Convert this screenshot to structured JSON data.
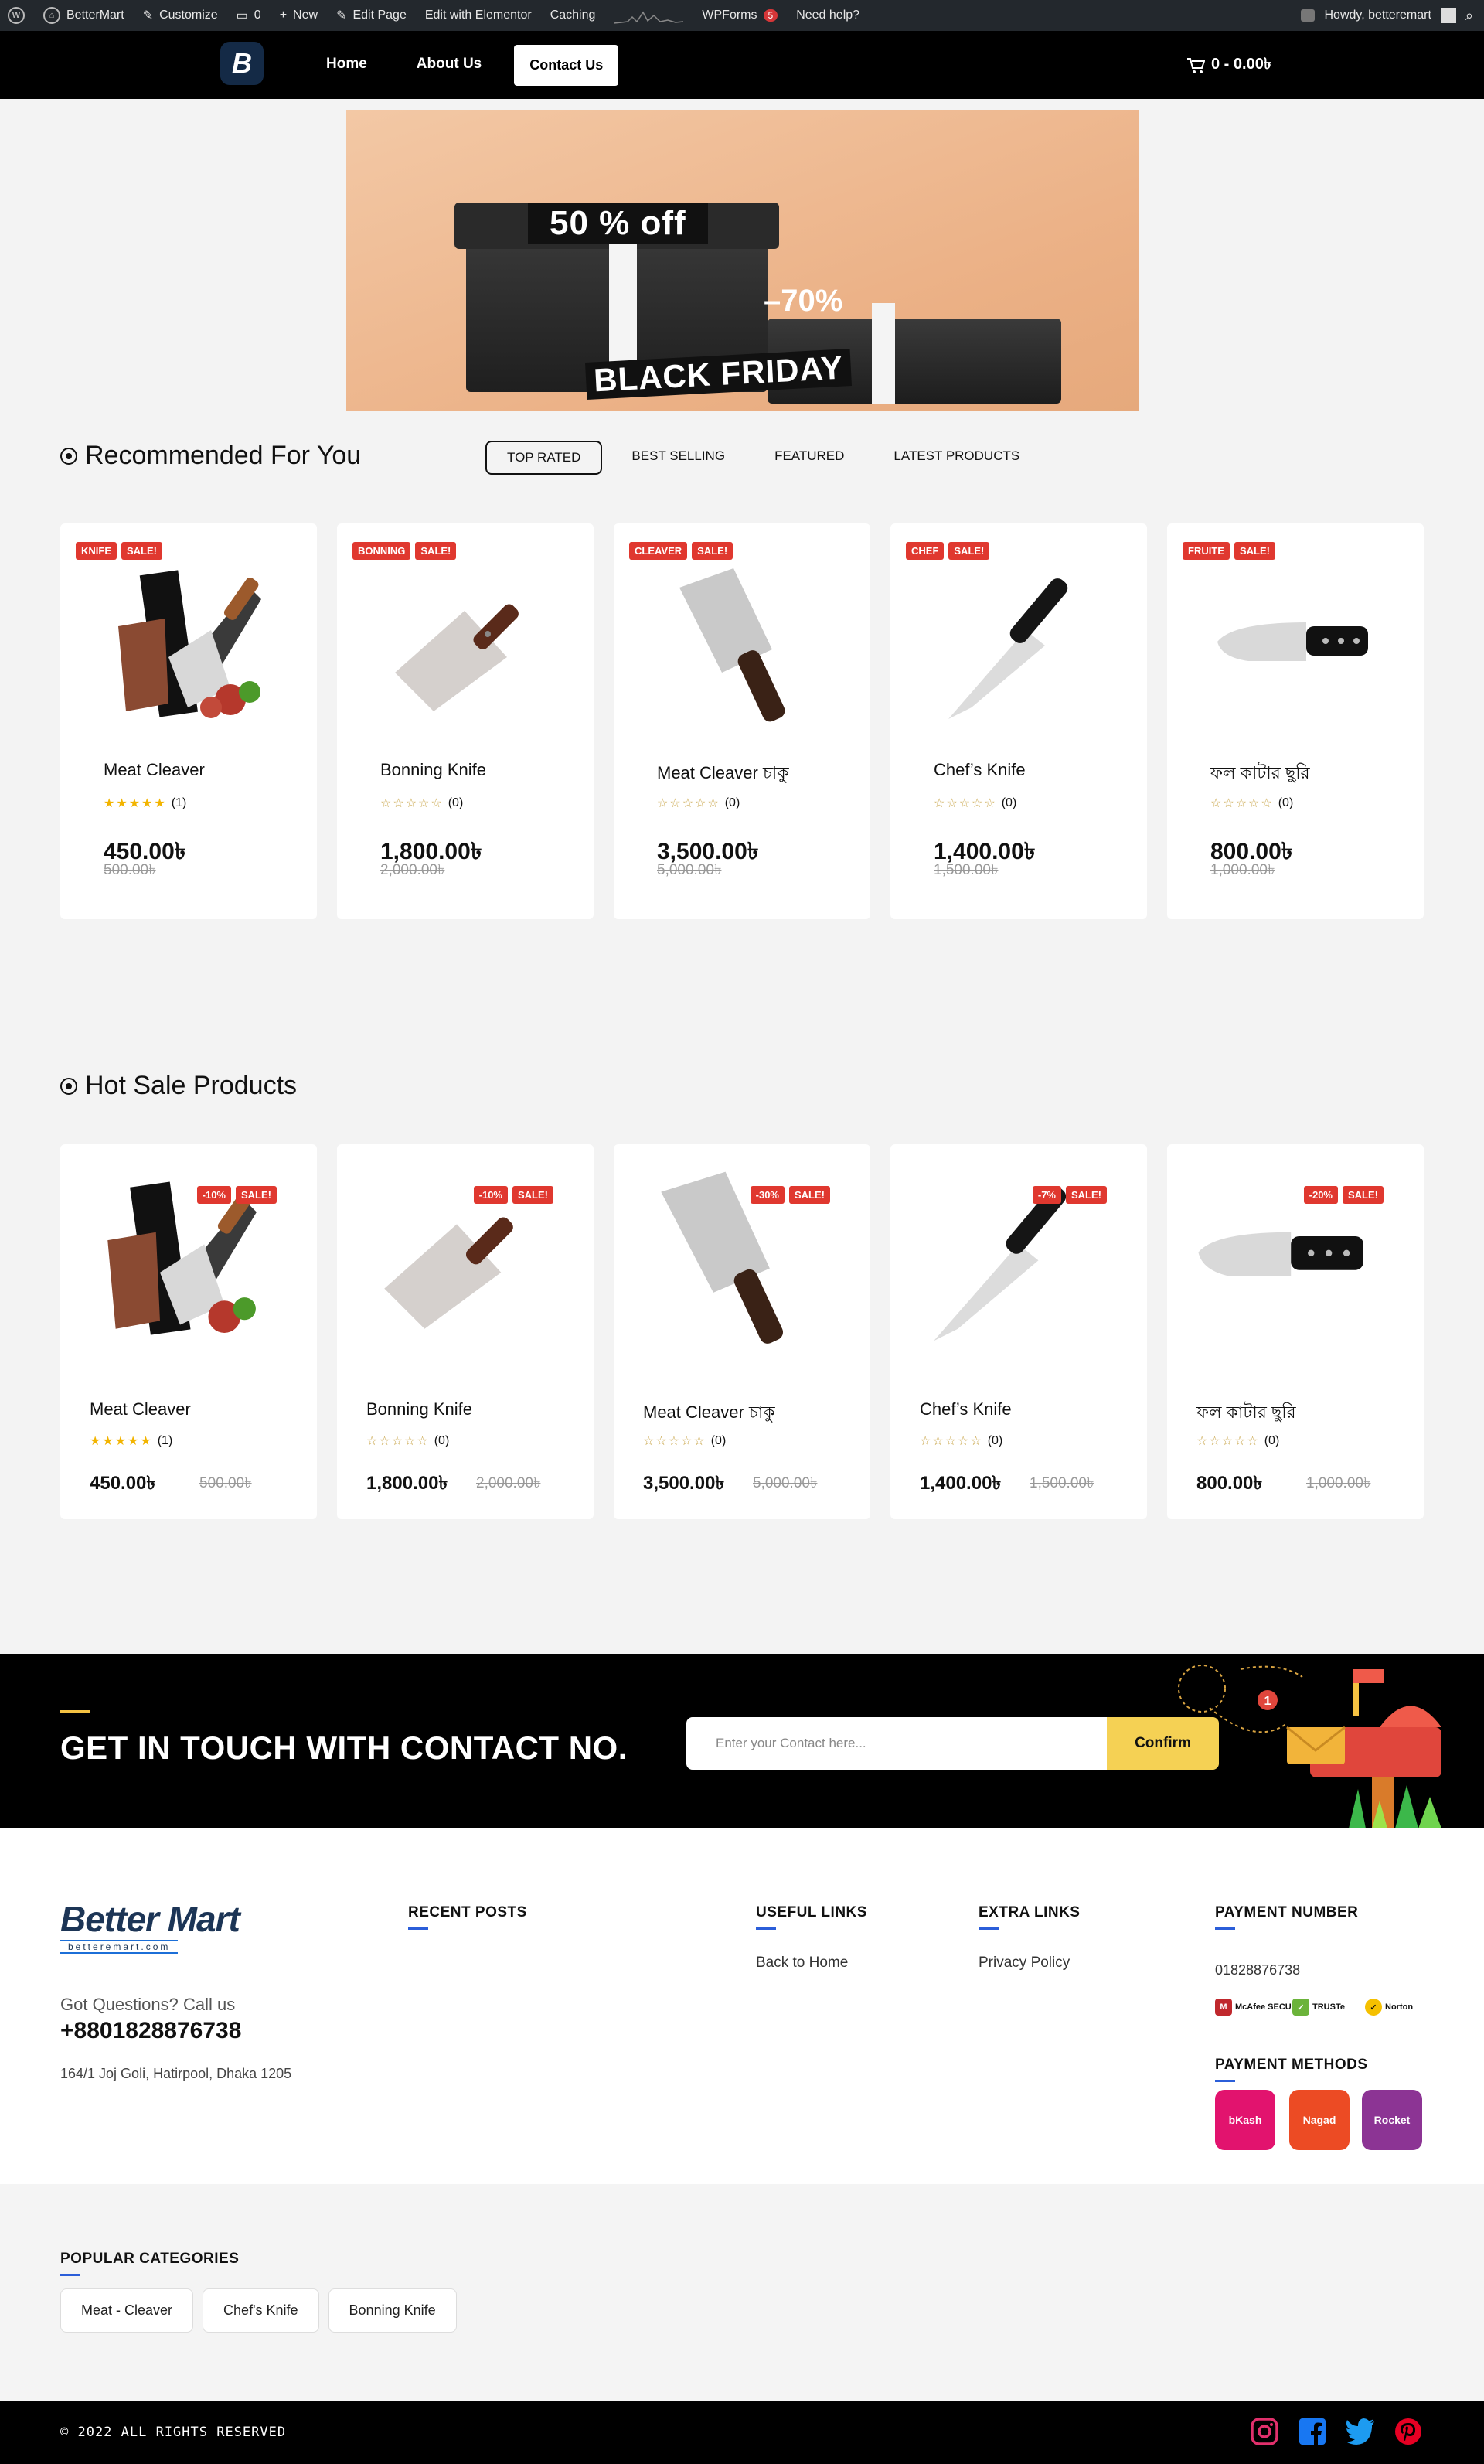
{
  "adminbar": {
    "site": "BetterMart",
    "customize": "Customize",
    "comments": "0",
    "new": "New",
    "edit_page": "Edit Page",
    "elementor": "Edit with Elementor",
    "caching": "Caching",
    "wpforms": "WPForms",
    "wpforms_count": "5",
    "help": "Need help?",
    "howdy": "Howdy, betteremart"
  },
  "header": {
    "logo_letter": "B",
    "nav": [
      "Home",
      "About Us",
      "Contact Us"
    ],
    "cart": "0 - 0.00৳"
  },
  "banner": {
    "line1": "50 % off",
    "line2": "–70%",
    "line3": "BLACK FRIDAY"
  },
  "recommended": {
    "title": "Recommended For You",
    "tabs": [
      "TOP RATED",
      "BEST SELLING",
      "FEATURED",
      "LATEST PRODUCTS"
    ],
    "products": [
      {
        "name": "Meat Cleaver",
        "badge1": "KNIFE",
        "badge2": "SALE!",
        "rating": "(1)",
        "stars": "★★★★★",
        "price": "450.00৳",
        "old": "500.00৳"
      },
      {
        "name": "Bonning Knife",
        "badge1": "BONNING",
        "badge2": "SALE!",
        "rating": "(0)",
        "stars": "☆☆☆☆☆",
        "price": "1,800.00৳",
        "old": "2,000.00৳"
      },
      {
        "name": "Meat Cleaver চাকু",
        "badge1": "CLEAVER",
        "badge2": "SALE!",
        "rating": "(0)",
        "stars": "☆☆☆☆☆",
        "price": "3,500.00৳",
        "old": "5,000.00৳"
      },
      {
        "name": "Chef’s Knife",
        "badge1": "CHEF",
        "badge2": "SALE!",
        "rating": "(0)",
        "stars": "☆☆☆☆☆",
        "price": "1,400.00৳",
        "old": "1,500.00৳"
      },
      {
        "name": "ফল কাটার ছুরি",
        "badge1": "FRUITE",
        "badge2": "SALE!",
        "rating": "(0)",
        "stars": "☆☆☆☆☆",
        "price": "800.00৳",
        "old": "1,000.00৳"
      }
    ]
  },
  "hot": {
    "title": "Hot Sale Products",
    "products": [
      {
        "name": "Meat Cleaver",
        "discount": "-10%",
        "sale": "SALE!",
        "rating": "(1)",
        "stars": "★★★★★",
        "price": "450.00৳",
        "old": "500.00৳"
      },
      {
        "name": "Bonning Knife",
        "discount": "-10%",
        "sale": "SALE!",
        "rating": "(0)",
        "stars": "☆☆☆☆☆",
        "price": "1,800.00৳",
        "old": "2,000.00৳"
      },
      {
        "name": "Meat Cleaver চাকু",
        "discount": "-30%",
        "sale": "SALE!",
        "rating": "(0)",
        "stars": "☆☆☆☆☆",
        "price": "3,500.00৳",
        "old": "5,000.00৳"
      },
      {
        "name": "Chef’s Knife",
        "discount": "-7%",
        "sale": "SALE!",
        "rating": "(0)",
        "stars": "☆☆☆☆☆",
        "price": "1,400.00৳",
        "old": "1,500.00৳"
      },
      {
        "name": "ফল কাটার ছুরি",
        "discount": "-20%",
        "sale": "SALE!",
        "rating": "(0)",
        "stars": "☆☆☆☆☆",
        "price": "800.00৳",
        "old": "1,000.00৳"
      }
    ]
  },
  "contact": {
    "title": "GET IN TOUCH WITH CONTACT NO.",
    "placeholder": "Enter your Contact here...",
    "button": "Confirm",
    "notification": "1"
  },
  "footer": {
    "logo_text": "Better Mart",
    "logo_sub": "betteremart.com",
    "question": "Got Questions? Call us",
    "phone": "+8801828876738",
    "address": "164/1 Joj Goli, Hatirpool, Dhaka 1205",
    "recent_posts": "RECENT POSTS",
    "useful_links": "USEFUL LINKS",
    "useful_items": [
      "Back to Home"
    ],
    "extra_links": "EXTRA LINKS",
    "extra_items": [
      "Privacy Policy"
    ],
    "payment_number": "PAYMENT NUMBER",
    "payment_number_value": "01828876738",
    "secure_badges": [
      "McAfee SECURE",
      "TRUSTe",
      "Norton"
    ],
    "payment_methods": "PAYMENT METHODS",
    "methods": [
      "bKash",
      "Nagad",
      "Rocket"
    ]
  },
  "popular": {
    "title": "POPULAR CATEGORIES",
    "chips": [
      "Meat - Cleaver",
      "Chef's Knife",
      "Bonning Knife"
    ]
  },
  "bottom": {
    "copyright": "© 2022 ALL RIGHTS RESERVED",
    "social": [
      "instagram-icon",
      "facebook-icon",
      "twitter-icon",
      "pinterest-icon"
    ]
  },
  "colors": {
    "accent_red": "#e0382f",
    "accent_yellow": "#f5d154",
    "dark": "#000000",
    "link_blue": "#2b5ed9"
  }
}
